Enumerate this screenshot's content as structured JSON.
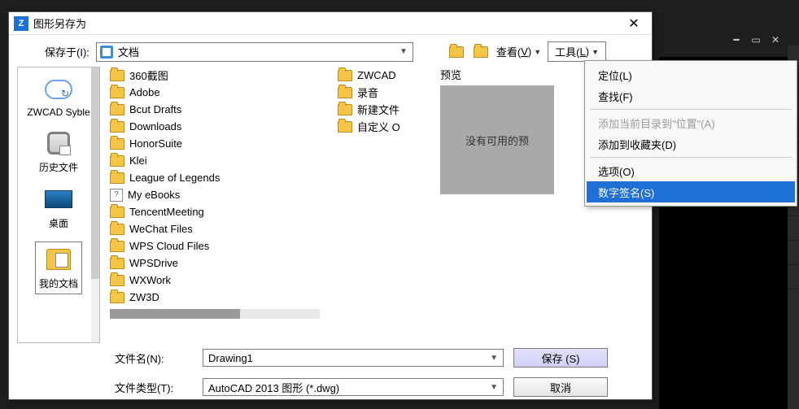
{
  "dialog": {
    "title": "图形另存为",
    "save_in_label": "保存于(I):",
    "save_in_value": "文档",
    "view_label_pre": "查看(",
    "view_label_u": "V",
    "view_label_post": ")",
    "tools_label_pre": "工具(",
    "tools_label_u": "L",
    "tools_label_post": ")"
  },
  "places": {
    "p0": "ZWCAD Syble",
    "p1": "历史文件",
    "p2": "桌面",
    "p3": "我的文档"
  },
  "files_col1": {
    "f0": "360截图",
    "f1": "Adobe",
    "f2": "Bcut Drafts",
    "f3": "Downloads",
    "f4": "HonorSuite",
    "f5": "Klei",
    "f6": "League of Legends",
    "f7": "My eBooks",
    "f8": "TencentMeeting",
    "f9": "WeChat Files",
    "f10": "WPS Cloud Files",
    "f11": "WPSDrive",
    "f12": "WXWork",
    "f13": "ZW3D"
  },
  "files_col2": {
    "f0": "ZWCAD",
    "f1": "录音",
    "f2": "新建文件",
    "f3": "自定义 O"
  },
  "preview": {
    "label": "预览",
    "empty": "没有可用的预"
  },
  "bottom": {
    "fname_label": "文件名(N):",
    "fname_value": "Drawing1",
    "ftype_label": "文件类型(T):",
    "ftype_value": "AutoCAD 2013 图形 (*.dwg)",
    "save_btn": "保存 (S)",
    "cancel_btn": "取消"
  },
  "menu": {
    "m0": "定位(L)",
    "m1": "查找(F)",
    "m2": "添加当前目录到\"位置\"(A)",
    "m3": "添加到收藏夹(D)",
    "m4": "选项(O)",
    "m5": "数字签名(S)"
  }
}
